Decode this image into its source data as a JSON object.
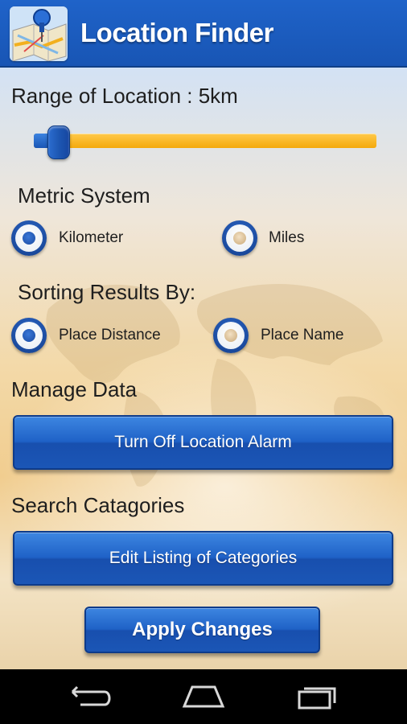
{
  "app": {
    "title": "Location Finder",
    "icon": "map-pin-icon"
  },
  "range": {
    "label": "Range of Location : 5km",
    "slider_fraction": 0.07
  },
  "metric": {
    "label": "Metric System",
    "options": [
      {
        "label": "Kilometer",
        "selected": true
      },
      {
        "label": "Miles",
        "selected": false
      }
    ]
  },
  "sorting": {
    "label": "Sorting Results By:",
    "options": [
      {
        "label": "Place Distance",
        "selected": true
      },
      {
        "label": "Place Name",
        "selected": false
      }
    ]
  },
  "manage": {
    "label": "Manage Data",
    "button": "Turn Off Location Alarm"
  },
  "search": {
    "label": "Search Catagories",
    "button": "Edit Listing of Categories"
  },
  "apply_button": "Apply Changes",
  "nav": {
    "back_icon": "back-icon",
    "home_icon": "home-icon",
    "recents_icon": "recents-icon"
  },
  "colors": {
    "accent_blue": "#1f62c7",
    "slider_orange": "#f4a90c"
  }
}
